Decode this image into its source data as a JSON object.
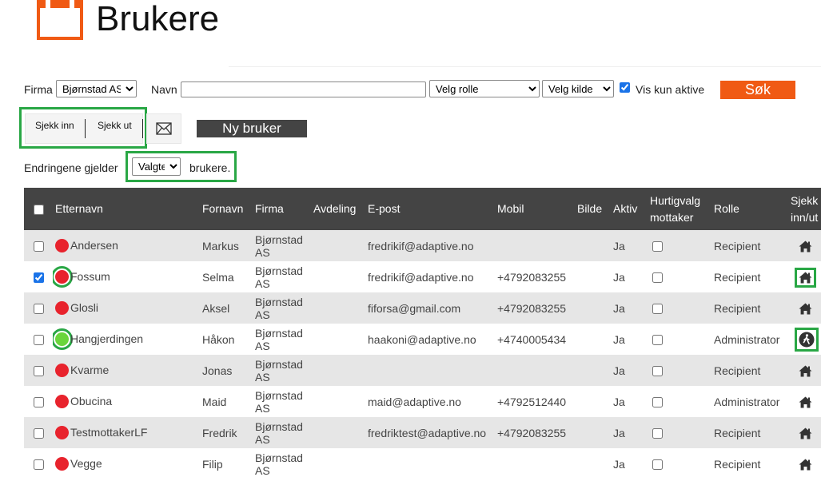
{
  "header": {
    "title": "Brukere",
    "icon": "calendar-icon",
    "icon_color": "#f05a14"
  },
  "filters": {
    "firma_label": "Firma",
    "firma_value": "Bjørnstad AS",
    "navn_label": "Navn",
    "navn_value": "",
    "rolle_value": "Velg rolle",
    "kilde_value": "Velg kilde",
    "vis_aktive_label": "Vis kun aktive",
    "vis_aktive_checked": true,
    "search_label": "Søk"
  },
  "actions": {
    "sjekk_inn": "Sjekk inn",
    "sjekk_ut": "Sjekk ut",
    "mail_icon": "envelope-icon",
    "new_user": "Ny bruker",
    "changes_prefix": "Endringene gjelder",
    "changes_select": "Valgte",
    "changes_suffix": "brukere."
  },
  "colors": {
    "accent": "#f05a14",
    "header_bg": "#444444",
    "highlight": "#29a745",
    "status_red": "#e8232d",
    "status_green": "#6ad53c"
  },
  "table": {
    "columns": [
      "Etternavn",
      "Fornavn",
      "Firma",
      "Avdeling",
      "E-post",
      "Mobil",
      "Bilde",
      "Aktiv",
      "Hurtigvalg mottaker",
      "Rolle",
      "Sjekk inn/ut"
    ],
    "rows": [
      {
        "checked": false,
        "status": "red",
        "etternavn": "Andersen",
        "fornavn": "Markus",
        "firma": "Bjørnstad AS",
        "avdeling": "",
        "epost": "fredrikif@adaptive.no",
        "mobil": "",
        "bilde": "",
        "aktiv": "Ja",
        "hurtig": false,
        "rolle": "Recipient",
        "sjekk": "home"
      },
      {
        "checked": true,
        "status": "red",
        "etternavn": "Fossum",
        "fornavn": "Selma",
        "firma": "Bjørnstad AS",
        "avdeling": "",
        "epost": "fredrikif@adaptive.no",
        "mobil": "+4792083255",
        "bilde": "",
        "aktiv": "Ja",
        "hurtig": false,
        "rolle": "Recipient",
        "sjekk": "home"
      },
      {
        "checked": false,
        "status": "red",
        "etternavn": "Glosli",
        "fornavn": "Aksel",
        "firma": "Bjørnstad AS",
        "avdeling": "",
        "epost": "fiforsa@gmail.com",
        "mobil": "+4792083255",
        "bilde": "",
        "aktiv": "Ja",
        "hurtig": false,
        "rolle": "Recipient",
        "sjekk": "home"
      },
      {
        "checked": false,
        "status": "green",
        "etternavn": "Hangjerdingen",
        "fornavn": "Håkon",
        "firma": "Bjørnstad AS",
        "avdeling": "",
        "epost": "haakoni@adaptive.no",
        "mobil": "+4740005434",
        "bilde": "",
        "aktiv": "Ja",
        "hurtig": false,
        "rolle": "Administrator",
        "sjekk": "walk"
      },
      {
        "checked": false,
        "status": "red",
        "etternavn": "Kvarme",
        "fornavn": "Jonas",
        "firma": "Bjørnstad AS",
        "avdeling": "",
        "epost": "",
        "mobil": "",
        "bilde": "",
        "aktiv": "Ja",
        "hurtig": false,
        "rolle": "Recipient",
        "sjekk": "home"
      },
      {
        "checked": false,
        "status": "red",
        "etternavn": "Obucina",
        "fornavn": "Maid",
        "firma": "Bjørnstad AS",
        "avdeling": "",
        "epost": "maid@adaptive.no",
        "mobil": "+4792512440",
        "bilde": "",
        "aktiv": "Ja",
        "hurtig": false,
        "rolle": "Administrator",
        "sjekk": "home"
      },
      {
        "checked": false,
        "status": "red",
        "etternavn": "TestmottakerLF",
        "fornavn": "Fredrik",
        "firma": "Bjørnstad AS",
        "avdeling": "",
        "epost": "fredriktest@adaptive.no",
        "mobil": "+4792083255",
        "bilde": "",
        "aktiv": "Ja",
        "hurtig": false,
        "rolle": "Recipient",
        "sjekk": "home"
      },
      {
        "checked": false,
        "status": "red",
        "etternavn": "Vegge",
        "fornavn": "Filip",
        "firma": "Bjørnstad AS",
        "avdeling": "",
        "epost": "",
        "mobil": "",
        "bilde": "",
        "aktiv": "Ja",
        "hurtig": false,
        "rolle": "Recipient",
        "sjekk": "home"
      }
    ]
  }
}
